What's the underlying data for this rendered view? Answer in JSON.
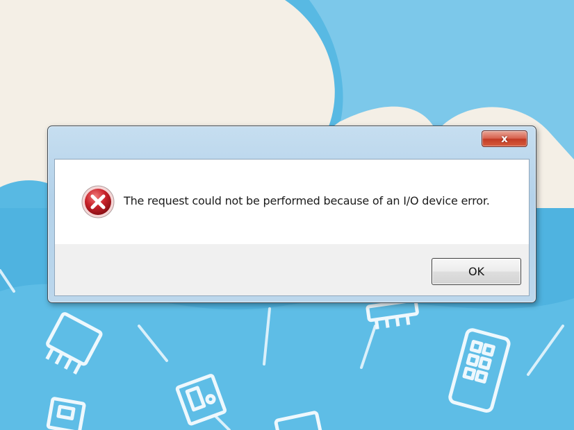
{
  "dialog": {
    "close_label": "x",
    "message": "The request could not be performed because of an I/O device error.",
    "ok_label": "OK",
    "icon": "error-icon"
  },
  "colors": {
    "background_blue": "#4fb4e0",
    "close_button_red": "#c94a33",
    "error_icon_red": "#c8222a"
  }
}
